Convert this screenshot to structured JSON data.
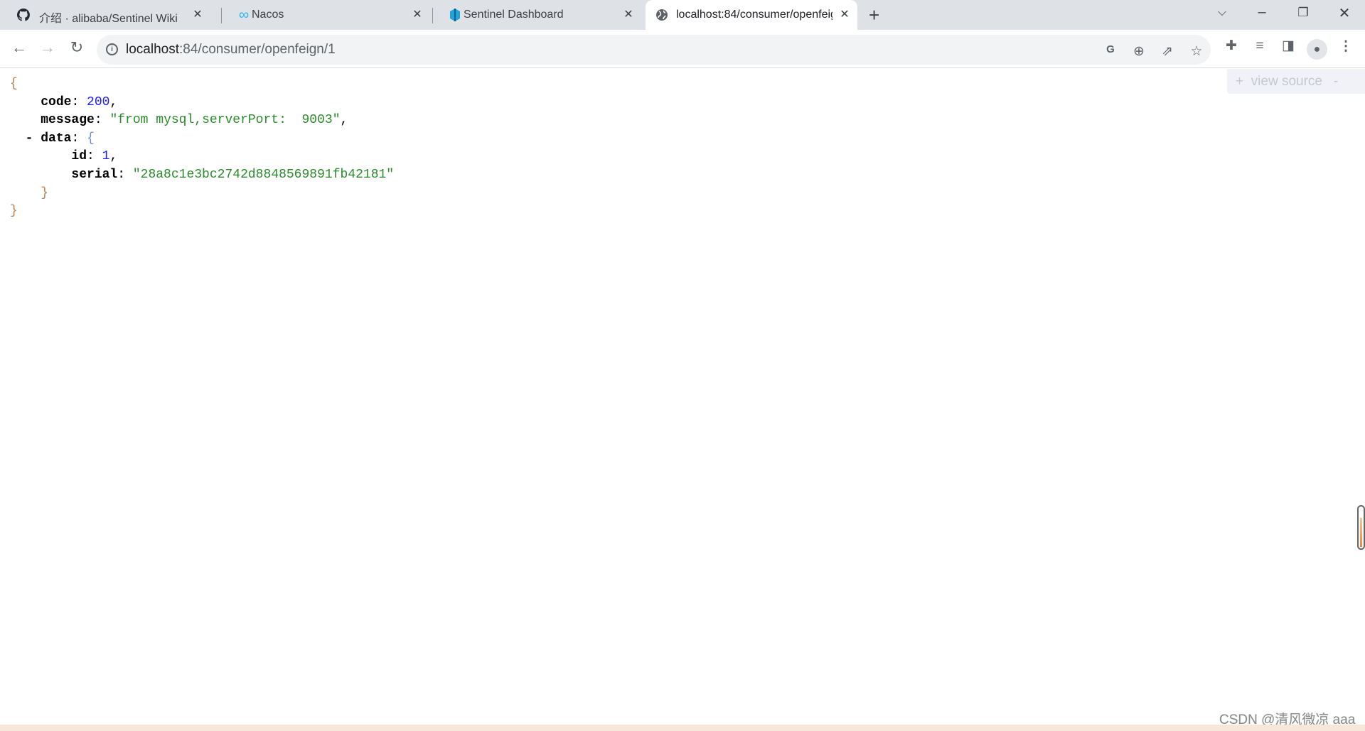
{
  "browser": {
    "tabs": [
      {
        "title": "介绍 · alibaba/Sentinel Wiki",
        "icon": "github-icon"
      },
      {
        "title": "Nacos",
        "icon": "nacos-infinity-icon"
      },
      {
        "title": "Sentinel Dashboard",
        "icon": "sentinel-icon"
      },
      {
        "title": "localhost:84/consumer/openfeign/1",
        "icon": "globe-icon",
        "active": true
      }
    ],
    "address": {
      "host": "localhost",
      "rest": ":84/consumer/openfeign/1"
    },
    "view_source": {
      "plus": "+",
      "label": "view source",
      "minus": "-"
    }
  },
  "json_view": {
    "open": "{",
    "close": "}",
    "code_key": "code",
    "code_value": "200",
    "message_key": "message",
    "message_value": "\"from mysql,serverPort:  9003\"",
    "data_toggle": "-",
    "data_key": "data",
    "id_key": "id",
    "id_value": "1",
    "serial_key": "serial",
    "serial_value": "\"28a8c1e3bc2742d8848569891fb42181\""
  },
  "watermark": "CSDN @清风微凉 aaa",
  "colors": {
    "number": "#1a1aff",
    "string": "#2a8a2a",
    "brace": "#b9824f"
  }
}
